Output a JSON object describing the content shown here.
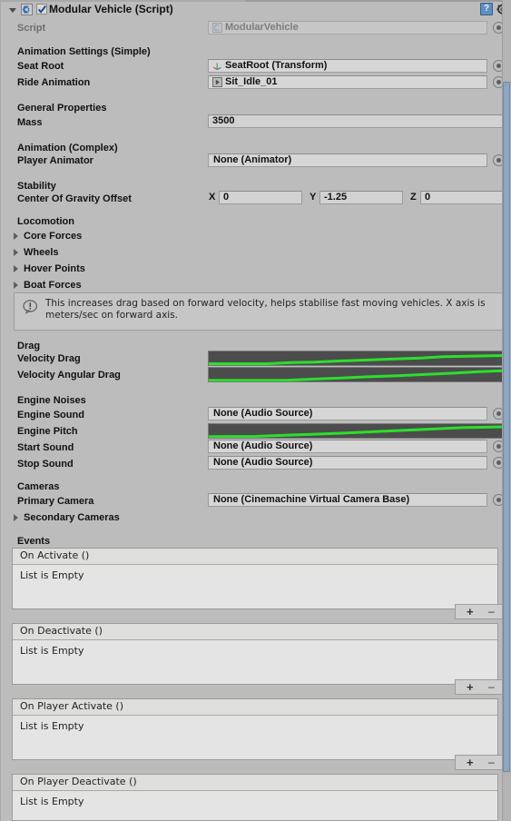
{
  "header": {
    "title": "Modular Vehicle (Script)",
    "enabled": true,
    "script_icon": "csharp-script-icon",
    "help_icon": "help-icon",
    "gear_icon": "gear-icon"
  },
  "script_row": {
    "label": "Script",
    "value": "ModularVehicle",
    "icon": "csharp-script-icon"
  },
  "sections": {
    "animation_simple": "Animation Settings (Simple)",
    "general_properties": "General Properties",
    "animation_complex": "Animation (Complex)",
    "stability": "Stability",
    "locomotion": "Locomotion",
    "drag": "Drag",
    "engine_noises": "Engine Noises",
    "cameras": "Cameras",
    "events": "Events"
  },
  "fields": {
    "seat_root": {
      "label": "Seat Root",
      "value": "SeatRoot (Transform)",
      "icon": "transform-axis-icon"
    },
    "ride_animation": {
      "label": "Ride Animation",
      "value": "Sit_Idle_01",
      "icon": "animation-clip-icon"
    },
    "mass": {
      "label": "Mass",
      "value": "3500"
    },
    "player_animator": {
      "label": "Player Animator",
      "value": "None (Animator)"
    },
    "center_of_gravity": {
      "label": "Center Of Gravity Offset",
      "x_label": "X",
      "x": "0",
      "y_label": "Y",
      "y": "-1.25",
      "z_label": "Z",
      "z": "0"
    },
    "engine_sound": {
      "label": "Engine Sound",
      "value": "None (Audio Source)"
    },
    "start_sound": {
      "label": "Start Sound",
      "value": "None (Audio Source)"
    },
    "stop_sound": {
      "label": "Stop Sound",
      "value": "None (Audio Source)"
    },
    "primary_camera": {
      "label": "Primary Camera",
      "value": "None (Cinemachine Virtual Camera Base)"
    }
  },
  "foldouts": [
    {
      "label": "Core Forces",
      "expanded": false
    },
    {
      "label": "Wheels",
      "expanded": false
    },
    {
      "label": "Hover Points",
      "expanded": false
    },
    {
      "label": "Boat Forces",
      "expanded": false
    }
  ],
  "secondary_cameras": {
    "label": "Secondary Cameras",
    "expanded": false
  },
  "help_box": {
    "icon": "info-bubble-icon",
    "text": "This increases drag based on forward velocity, helps stabilise fast moving vehicles. X axis is meters/sec on forward axis."
  },
  "curves": [
    {
      "label": "Velocity Drag",
      "curve_color": "#2cdf2c",
      "background": "#4c4c4c",
      "points": [
        [
          0,
          0.1
        ],
        [
          0.2,
          0.1
        ],
        [
          0.28,
          0.18
        ],
        [
          0.36,
          0.22
        ],
        [
          0.44,
          0.3
        ],
        [
          0.52,
          0.36
        ],
        [
          0.62,
          0.44
        ],
        [
          0.72,
          0.52
        ],
        [
          0.8,
          0.62
        ],
        [
          1.0,
          0.7
        ]
      ]
    },
    {
      "label": "Velocity Angular Drag",
      "curve_color": "#2cdf2c",
      "background": "#4c4c4c",
      "points": [
        [
          0,
          0.08
        ],
        [
          0.26,
          0.08
        ],
        [
          0.34,
          0.16
        ],
        [
          0.44,
          0.24
        ],
        [
          0.54,
          0.34
        ],
        [
          0.64,
          0.42
        ],
        [
          0.74,
          0.52
        ],
        [
          0.84,
          0.62
        ],
        [
          0.92,
          0.72
        ],
        [
          1.0,
          0.78
        ]
      ]
    },
    {
      "label": "Engine Pitch",
      "curve_color": "#2cdf2c",
      "background": "#4c4c4c",
      "points": [
        [
          0,
          0.08
        ],
        [
          0.16,
          0.1
        ],
        [
          0.26,
          0.18
        ],
        [
          0.36,
          0.26
        ],
        [
          0.46,
          0.34
        ],
        [
          0.56,
          0.44
        ],
        [
          0.66,
          0.54
        ],
        [
          0.76,
          0.64
        ],
        [
          0.86,
          0.74
        ],
        [
          1.0,
          0.8
        ]
      ]
    }
  ],
  "events": [
    {
      "title": "On Activate ()",
      "empty_text": "List is Empty",
      "add_label": "+",
      "remove_label": "–"
    },
    {
      "title": "On Deactivate ()",
      "empty_text": "List is Empty",
      "add_label": "+",
      "remove_label": "–"
    },
    {
      "title": "On Player Activate ()",
      "empty_text": "List is Empty",
      "add_label": "+",
      "remove_label": "–"
    },
    {
      "title": "On Player Deactivate ()",
      "empty_text": "List is Empty",
      "add_label": "+",
      "remove_label": "–"
    }
  ],
  "colors": {
    "panel_bg": "#bcbcbc",
    "field_bg": "#d6d6d6",
    "curve_bg": "#4c4c4c",
    "curve_line": "#2cdf2c",
    "scrollbar_thumb": "#8fa6c2",
    "accent_blue": "#5f8ec4"
  }
}
